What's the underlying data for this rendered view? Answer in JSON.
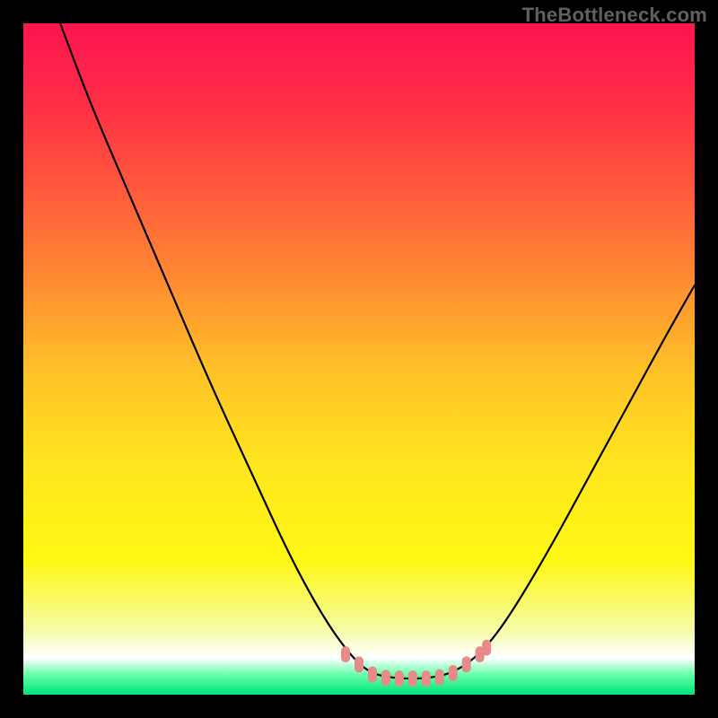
{
  "watermark": "TheBottleneck.com",
  "chart_data": {
    "type": "line",
    "title": "",
    "xlabel": "",
    "ylabel": "",
    "xlim": [
      0,
      100
    ],
    "ylim": [
      0,
      100
    ],
    "grid": false,
    "background_gradient": {
      "stops": [
        {
          "offset": 0.0,
          "color": "#ff1450"
        },
        {
          "offset": 0.12,
          "color": "#ff2e46"
        },
        {
          "offset": 0.25,
          "color": "#ff5a3c"
        },
        {
          "offset": 0.38,
          "color": "#ff8a32"
        },
        {
          "offset": 0.52,
          "color": "#ffc228"
        },
        {
          "offset": 0.66,
          "color": "#ffe61e"
        },
        {
          "offset": 0.8,
          "color": "#fff814"
        },
        {
          "offset": 0.9,
          "color": "#f5fca0"
        },
        {
          "offset": 0.945,
          "color": "#ffffff"
        },
        {
          "offset": 0.97,
          "color": "#66ffaa"
        },
        {
          "offset": 1.0,
          "color": "#00e27a"
        }
      ]
    },
    "series": [
      {
        "name": "bottleneck-curve",
        "stroke": "#000000",
        "stroke_width": 2.2,
        "points": [
          {
            "x": 5.5,
            "y": 100.0
          },
          {
            "x": 10.0,
            "y": 88.0
          },
          {
            "x": 16.0,
            "y": 74.0
          },
          {
            "x": 22.0,
            "y": 60.0
          },
          {
            "x": 28.0,
            "y": 46.0
          },
          {
            "x": 34.0,
            "y": 33.0
          },
          {
            "x": 40.0,
            "y": 20.0
          },
          {
            "x": 45.0,
            "y": 11.0
          },
          {
            "x": 49.0,
            "y": 5.5
          },
          {
            "x": 52.0,
            "y": 3.0
          },
          {
            "x": 56.0,
            "y": 2.4
          },
          {
            "x": 60.0,
            "y": 2.4
          },
          {
            "x": 64.0,
            "y": 3.2
          },
          {
            "x": 68.0,
            "y": 6.0
          },
          {
            "x": 72.0,
            "y": 11.0
          },
          {
            "x": 78.0,
            "y": 21.0
          },
          {
            "x": 84.0,
            "y": 32.0
          },
          {
            "x": 90.0,
            "y": 43.0
          },
          {
            "x": 96.0,
            "y": 54.0
          },
          {
            "x": 100.0,
            "y": 61.0
          }
        ]
      }
    ],
    "markers": {
      "name": "bottom-markers",
      "fill": "#e98a8a",
      "points": [
        {
          "x": 48.0,
          "y": 6.0
        },
        {
          "x": 50.0,
          "y": 4.5
        },
        {
          "x": 52.0,
          "y": 3.0
        },
        {
          "x": 54.0,
          "y": 2.5
        },
        {
          "x": 56.0,
          "y": 2.4
        },
        {
          "x": 58.0,
          "y": 2.4
        },
        {
          "x": 60.0,
          "y": 2.4
        },
        {
          "x": 62.0,
          "y": 2.6
        },
        {
          "x": 64.0,
          "y": 3.2
        },
        {
          "x": 66.0,
          "y": 4.5
        },
        {
          "x": 68.0,
          "y": 6.0
        },
        {
          "x": 69.0,
          "y": 7.0
        }
      ]
    }
  }
}
